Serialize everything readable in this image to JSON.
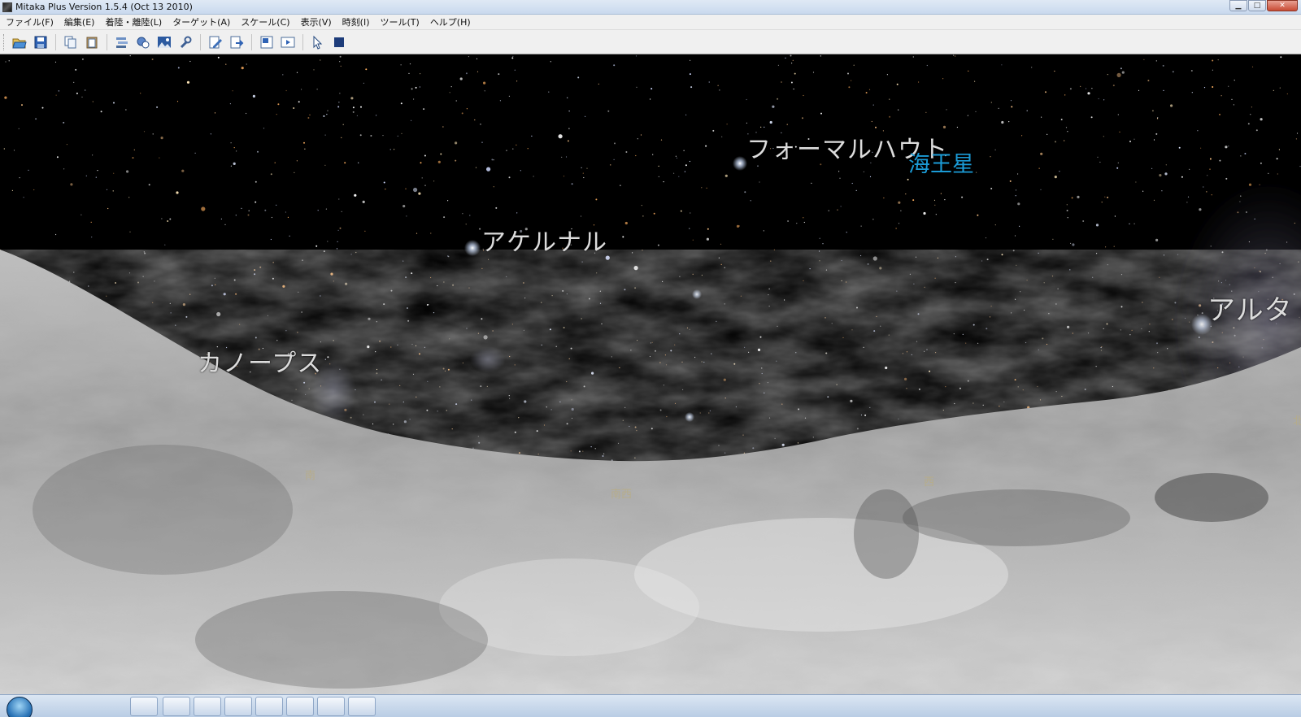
{
  "window": {
    "title": "Mitaka Plus Version 1.5.4 (Oct 13 2010)",
    "controls": {
      "minimize": "▁",
      "maximize": "□",
      "close": "✕"
    }
  },
  "menu": {
    "items": [
      {
        "label": "ファイル(F)"
      },
      {
        "label": "編集(E)"
      },
      {
        "label": "着陸・離陸(L)"
      },
      {
        "label": "ターゲット(A)"
      },
      {
        "label": "スケール(C)"
      },
      {
        "label": "表示(V)"
      },
      {
        "label": "時刻(I)"
      },
      {
        "label": "ツール(T)"
      },
      {
        "label": "ヘルプ(H)"
      }
    ]
  },
  "toolbar": {
    "buttons": [
      {
        "icon": "open-folder-icon"
      },
      {
        "icon": "save-icon"
      },
      {
        "icon": "copy-icon"
      },
      {
        "icon": "paste-icon"
      },
      {
        "icon": "layers-icon"
      },
      {
        "icon": "planets-icon"
      },
      {
        "icon": "landscape-icon"
      },
      {
        "icon": "wrench-icon"
      },
      {
        "icon": "edit-icon"
      },
      {
        "icon": "export-icon"
      },
      {
        "icon": "image-icon"
      },
      {
        "icon": "movie-icon"
      },
      {
        "icon": "pointer-icon"
      },
      {
        "icon": "stop-icon"
      }
    ]
  },
  "sky": {
    "stars": [
      {
        "name": "フォーマルハウト"
      },
      {
        "name": "アケルナル"
      },
      {
        "name": "カノープス"
      },
      {
        "name": "アルタ"
      }
    ],
    "planets": [
      {
        "name": "海王星"
      }
    ],
    "directions": [
      {
        "label": "南"
      },
      {
        "label": "南西"
      },
      {
        "label": "西"
      },
      {
        "label": "北"
      }
    ],
    "colors": {
      "star_label": "#dcdcdc",
      "planet_label": "#1b9bd6",
      "direction_label": "#b9ad82"
    }
  }
}
